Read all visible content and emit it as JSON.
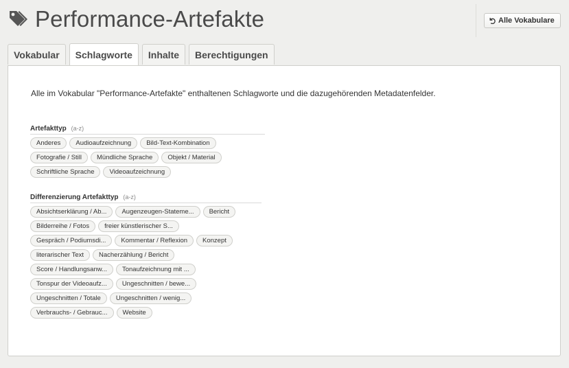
{
  "header": {
    "title": "Performance-Artefakte",
    "title_icon": "tag-icon",
    "vocab_button_label": "Alle Vokabulare",
    "vocab_button_icon": "undo-icon"
  },
  "tabs": [
    {
      "label": "Vokabular",
      "active": false
    },
    {
      "label": "Schlagworte",
      "active": true
    },
    {
      "label": "Inhalte",
      "active": false
    },
    {
      "label": "Berechtigungen",
      "active": false
    }
  ],
  "main": {
    "intro": "Alle im Vokabular \"Performance-Artefakte\" enthaltenen Schlagworte und die dazugehörenden Metadatenfelder.",
    "sections": [
      {
        "title": "Artefakttyp",
        "hint": "(a-z)",
        "tags": [
          "Anderes",
          "Audioaufzeichnung",
          "Bild-Text-Kombination",
          "Fotografie / Still",
          "Mündliche Sprache",
          "Objekt / Material",
          "Schriftliche Sprache",
          "Videoaufzeichnung"
        ]
      },
      {
        "title": "Differenzierung Artefakttyp",
        "hint": "(a-z)",
        "tags": [
          "Absichtserklärung / Ab...",
          "Augenzeugen-Stateme...",
          "Bericht",
          "Bilderreihe / Fotos",
          "freier künstlerischer S...",
          "Gespräch / Podiumsdi...",
          "Kommentar / Reflexion",
          "Konzept",
          "literarischer Text",
          "Nacherzählung / Bericht",
          "Score / Handlungsanw...",
          "Tonaufzeichnung mit ...",
          "Tonspur der Videoaufz...",
          "Ungeschnitten / bewe...",
          "Ungeschnitten / Totale",
          "Ungeschnitten / wenig...",
          "Verbrauchs- / Gebrauc...",
          "Website"
        ]
      }
    ]
  },
  "colors": {
    "page_background": "#efefed",
    "panel_background": "#ffffff",
    "chip_background": "#f4f4f2",
    "border": "#cfcfcb",
    "text": "#333333"
  }
}
